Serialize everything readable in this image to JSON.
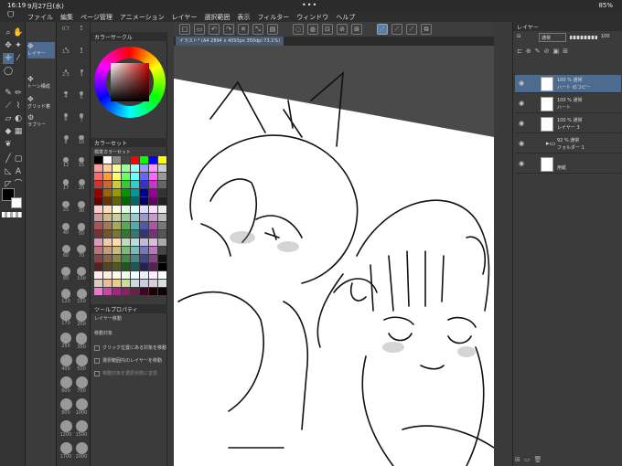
{
  "status": {
    "time": "16:19",
    "date": "9月27日(水)",
    "battery": "85%"
  },
  "menu": {
    "items": [
      "ファイル",
      "編集",
      "ページ管理",
      "アニメーション",
      "レイヤー",
      "選択範囲",
      "表示",
      "フィルター",
      "ウィンドウ",
      "ヘルプ"
    ]
  },
  "subtool": {
    "items": [
      "レイヤー",
      "トーン構成",
      "グリッド着",
      "ラブリー"
    ]
  },
  "brush_sizes": [
    "0.7",
    "1",
    "1.5",
    "2",
    "2.5",
    "3",
    "4",
    "5",
    "6",
    "7",
    "8",
    "10",
    "12",
    "15",
    "17",
    "20",
    "25",
    "30",
    "40",
    "50",
    "60",
    "70",
    "80",
    "100",
    "120",
    "150",
    "170",
    "200",
    "250",
    "300",
    "400",
    "500",
    "600",
    "700",
    "800",
    "1000",
    "1200",
    "1500",
    "1700",
    "2000"
  ],
  "color_panel": {
    "title": "カラーサークル",
    "set_title": "カラーセット",
    "set_name": "標準カラーセット",
    "tool_prop_title": "ツールプロパティ",
    "tool_name": "レイヤー移動",
    "move_target": "移動対象",
    "options": [
      "クリック位置にある対象を移動",
      "選択範囲内のレイヤーを移動",
      "移動対象を選択状態に変更"
    ]
  },
  "canvas": {
    "tab": "イラスト* (A4 2894 x 4093px 350dpi 73.1%)"
  },
  "layer_panel": {
    "title": "レイヤー",
    "blend": "通常",
    "opacity": "100",
    "layers": [
      {
        "line1": "100 % 通常",
        "line2": "ハート のコピー"
      },
      {
        "line1": "100 % 通常",
        "line2": "ハート"
      },
      {
        "line1": "100 % 通常",
        "line2": "レイヤー 3"
      },
      {
        "line1": "92 % 通常",
        "line2": "フォルダー 1"
      },
      {
        "line1": "",
        "line2": "用紙"
      }
    ]
  },
  "colors": {
    "accent": "#4c6b8f",
    "panel": "#3b3b3b",
    "canvas_bg": "#4a4a4a"
  }
}
